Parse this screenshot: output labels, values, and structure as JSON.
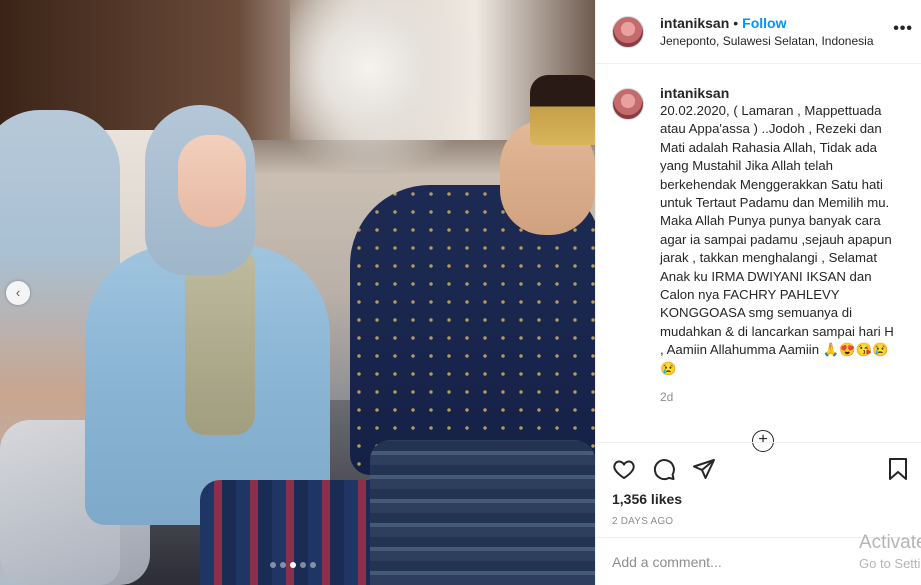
{
  "post": {
    "username": "intaniksan",
    "separator": "•",
    "follow_label": "Follow",
    "location": "Jeneponto, Sulawesi Selatan, Indonesia",
    "more_label": "•••"
  },
  "caption": {
    "username": "intaniksan",
    "text": "20.02.2020, ( Lamaran , Mappettuada atau Appa'assa ) ..Jodoh , Rezeki dan Mati adalah Rahasia Allah, Tidak ada yang Mustahil Jika Allah telah berkehendak Menggerakkan Satu hati untuk Tertaut Padamu dan Memilih mu. Maka Allah Punya punya banyak cara agar ia sampai padamu ,sejauh apapun jarak , takkan menghalangi , Selamat Anak ku IRMA DWIYANI IKSAN dan Calon nya FACHRY PAHLEVY KONGGOASA smg semuanya di mudahkan & di lancarkan sampai hari H , Aamiin Allahumma Aamiin 🙏😍😘😢😢",
    "time": "2d"
  },
  "load_more_label": "+",
  "stats": {
    "likes": "1,356 likes",
    "time_ago": "2 DAYS AGO"
  },
  "comment_box": {
    "placeholder": "Add a comment..."
  },
  "carousel": {
    "prev_label": "‹",
    "total": 5,
    "active_index": 2
  },
  "watermark": {
    "line1": "Activate Windows",
    "line2": "Go to Settings to activate Windows."
  },
  "icons": [
    "heart-icon",
    "comment-icon",
    "share-icon",
    "bookmark-icon",
    "chevron-left-icon",
    "plus-circle-icon"
  ],
  "colors": {
    "link": "#0095f6",
    "text": "#262626",
    "muted": "#8e8e8e",
    "border": "#efefef"
  }
}
